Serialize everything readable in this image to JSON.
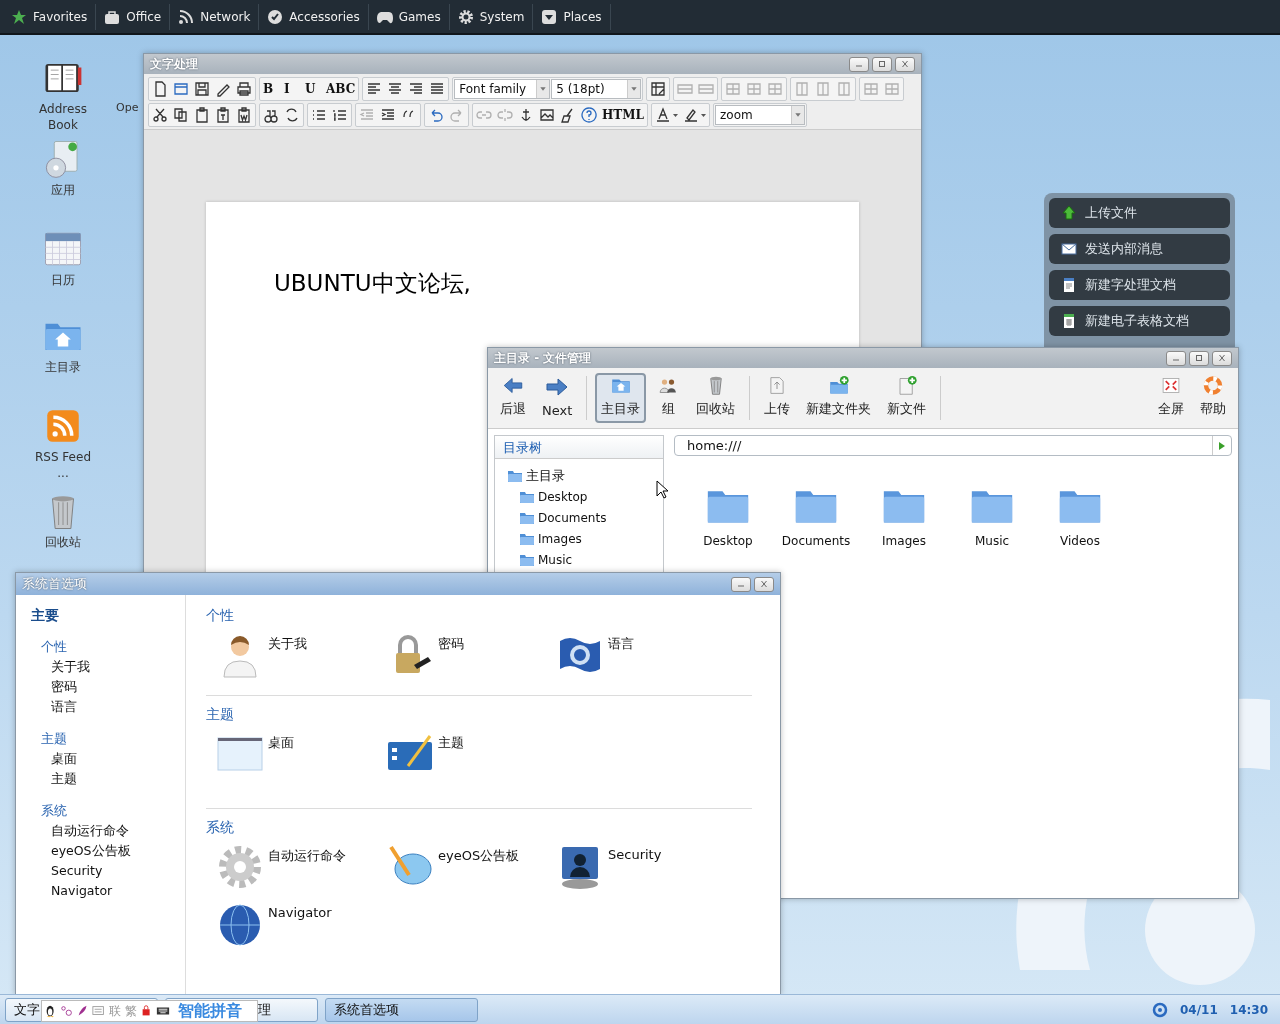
{
  "menu_bar": {
    "items": [
      {
        "label": "Favorites"
      },
      {
        "label": "Office"
      },
      {
        "label": "Network"
      },
      {
        "label": "Accessories"
      },
      {
        "label": "Games"
      },
      {
        "label": "System"
      },
      {
        "label": "Places"
      }
    ]
  },
  "desktop_icons": [
    {
      "label": "Address\nBook"
    },
    {
      "label": "应用"
    },
    {
      "label": "日历"
    },
    {
      "label": "主目录"
    },
    {
      "label": "RSS Feed\n..."
    },
    {
      "label": "回收站"
    }
  ],
  "hidden_icon_label": "Ope",
  "word_processor": {
    "title": "文字处理",
    "toolbar_row_1": [
      [
        {
          "kind": "button",
          "disabled": false
        },
        {
          "kind": "button",
          "disabled": false
        },
        {
          "kind": "button",
          "disabled": false
        },
        {
          "kind": "button",
          "disabled": false
        },
        {
          "kind": "button",
          "disabled": false
        }
      ],
      [
        {
          "kind": "button",
          "label": "B",
          "disabled": false
        },
        {
          "kind": "button",
          "label": "I",
          "disabled": false
        },
        {
          "kind": "button",
          "label": "U",
          "disabled": false
        },
        {
          "kind": "button",
          "label": "ABC",
          "disabled": false
        }
      ],
      [
        {
          "kind": "button",
          "disabled": false
        },
        {
          "kind": "button",
          "disabled": false
        },
        {
          "kind": "button",
          "disabled": false
        },
        {
          "kind": "button",
          "disabled": false
        }
      ],
      [
        {
          "kind": "select",
          "value": "Font family"
        },
        {
          "kind": "select",
          "value": "5 (18pt)"
        }
      ],
      [
        {
          "kind": "button",
          "disabled": false
        }
      ],
      [
        {
          "kind": "button",
          "disabled": true
        },
        {
          "kind": "button",
          "disabled": true
        }
      ],
      [
        {
          "kind": "button",
          "disabled": true
        },
        {
          "kind": "button",
          "disabled": true
        },
        {
          "kind": "button",
          "disabled": true
        }
      ],
      [
        {
          "kind": "button",
          "disabled": true
        },
        {
          "kind": "button",
          "disabled": true
        },
        {
          "kind": "button",
          "disabled": true
        }
      ],
      [
        {
          "kind": "button",
          "disabled": true
        },
        {
          "kind": "button",
          "disabled": true
        }
      ]
    ],
    "toolbar_row_2": [
      [
        {
          "kind": "button",
          "disabled": false
        },
        {
          "kind": "button",
          "disabled": false
        },
        {
          "kind": "button",
          "disabled": false
        },
        {
          "kind": "button",
          "disabled": false
        },
        {
          "kind": "button",
          "disabled": false
        }
      ],
      [
        {
          "kind": "button",
          "disabled": false
        },
        {
          "kind": "button",
          "disabled": false
        }
      ],
      [
        {
          "kind": "button",
          "disabled": false
        },
        {
          "kind": "button",
          "disabled": false
        }
      ],
      [
        {
          "kind": "button",
          "disabled": true
        },
        {
          "kind": "button",
          "disabled": false
        },
        {
          "kind": "button",
          "disabled": false
        }
      ],
      [
        {
          "kind": "button",
          "disabled": false
        },
        {
          "kind": "button",
          "disabled": true
        }
      ],
      [
        {
          "kind": "button",
          "disabled": true
        },
        {
          "kind": "button",
          "disabled": true
        },
        {
          "kind": "button",
          "disabled": false
        },
        {
          "kind": "button",
          "disabled": false
        },
        {
          "kind": "button",
          "disabled": false
        },
        {
          "kind": "button",
          "disabled": false
        },
        {
          "kind": "button",
          "label": "HTML",
          "disabled": false
        }
      ],
      [
        {
          "kind": "button",
          "disabled": false
        },
        {
          "kind": "button",
          "disabled": false
        }
      ],
      [
        {
          "kind": "select",
          "value": "zoom"
        }
      ]
    ],
    "document_text": "UBUNTU中文论坛,"
  },
  "quick_actions": [
    {
      "label": "上传文件"
    },
    {
      "label": "发送内部消息"
    },
    {
      "label": "新建字处理文档"
    },
    {
      "label": "新建电子表格文档"
    }
  ],
  "file_manager": {
    "title": "主目录 - 文件管理",
    "toolbar": [
      {
        "label": "后退",
        "selected": false
      },
      {
        "label": "Next",
        "selected": false
      },
      {
        "label": "主目录",
        "selected": true
      },
      {
        "label": "组",
        "selected": false
      },
      {
        "label": "回收站",
        "selected": false
      },
      {
        "label": "上传",
        "selected": false
      },
      {
        "label": "新建文件夹",
        "selected": false
      },
      {
        "label": "新文件",
        "selected": false
      },
      {
        "label": "全屏",
        "selected": false
      },
      {
        "label": "帮助",
        "selected": false
      }
    ],
    "tree_title": "目录树",
    "tree": [
      {
        "label": "主目录",
        "children": [
          {
            "label": "Desktop"
          },
          {
            "label": "Documents"
          },
          {
            "label": "Images"
          },
          {
            "label": "Music"
          }
        ]
      }
    ],
    "address": "home:///",
    "files": [
      {
        "name": "Desktop"
      },
      {
        "name": "Documents"
      },
      {
        "name": "Images"
      },
      {
        "name": "Music"
      },
      {
        "name": "Videos"
      }
    ]
  },
  "preferences": {
    "title": "系统首选项",
    "sidebar_title": "主要",
    "sidebar_groups": [
      {
        "title": "个性",
        "items": [
          "关于我",
          "密码",
          "语言"
        ]
      },
      {
        "title": "主题",
        "items": [
          "桌面",
          "主题"
        ]
      },
      {
        "title": "系统",
        "items": [
          "自动运行命令",
          "eyeOS公告板",
          "Security",
          "Navigator"
        ]
      }
    ],
    "sections": [
      {
        "title": "个性",
        "items": [
          {
            "label": "关于我"
          },
          {
            "label": "密码"
          },
          {
            "label": "语言"
          }
        ]
      },
      {
        "title": "主题",
        "items": [
          {
            "label": "桌面"
          },
          {
            "label": "主题"
          }
        ]
      },
      {
        "title": "系统",
        "items": [
          {
            "label": "自动运行命令"
          },
          {
            "label": "eyeOS公告板"
          },
          {
            "label": "Security"
          },
          {
            "label": "Navigator"
          }
        ]
      }
    ]
  },
  "taskbar": {
    "tasks": [
      {
        "label": "文字",
        "selected": false
      },
      {
        "label": "理",
        "selected": false
      },
      {
        "label": "系统首选项",
        "selected": true
      }
    ],
    "ime_bar": {
      "glyphs": [
        "联",
        "繁"
      ],
      "label": "智能拼音"
    },
    "date": "04/11",
    "time": "14:30"
  }
}
